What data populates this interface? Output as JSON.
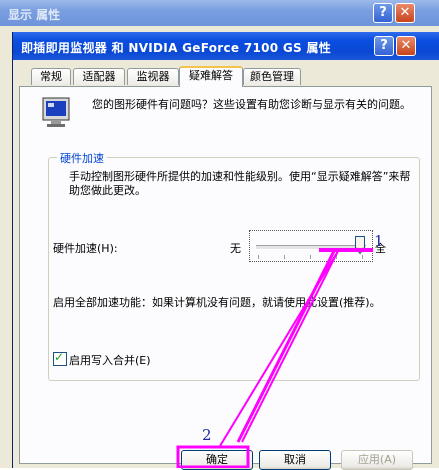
{
  "outer_window": {
    "title": "显示 属性",
    "help_label": "?",
    "close_label": "✕"
  },
  "dialog": {
    "title": "即插即用监视器 和 NVIDIA GeForce 7100 GS 属性",
    "help_label": "?",
    "close_label": "✕"
  },
  "tabs": [
    {
      "label": "常规",
      "active": false
    },
    {
      "label": "适配器",
      "active": false
    },
    {
      "label": "监视器",
      "active": false
    },
    {
      "label": "疑难解答",
      "active": true
    },
    {
      "label": "颜色管理",
      "active": false
    }
  ],
  "intro_text": "您的图形硬件有问题吗？这些设置有助您诊断与显示有关的问题。",
  "group": {
    "legend": "硬件加速",
    "description": "手动控制图形硬件所提供的加速和性能级别。使用“显示疑难解答”来帮助您做此更改。",
    "accel_label": "硬件加速(H):",
    "low_label": "无",
    "full_label": "全",
    "slider_level": 1.0,
    "recommend_text": "启用全部加速功能：如果计算机没有问题，就请使用此设置(推荐)。",
    "checkbox_label": "启用写入合并(E)",
    "checkbox_checked": true
  },
  "buttons": {
    "ok": "确定",
    "cancel": "取消",
    "apply": "应用(A)"
  },
  "annotations": {
    "marker_1": "1",
    "marker_2": "2",
    "color": "#ff00ff"
  },
  "colors": {
    "title_active": "#0a48d4",
    "title_inactive": "#7a9fe0",
    "dialog_bg": "#ece9d8",
    "panel_bg": "#fcfcfe",
    "tab_highlight": "#f5c34b",
    "group_legend": "#0046d5"
  }
}
